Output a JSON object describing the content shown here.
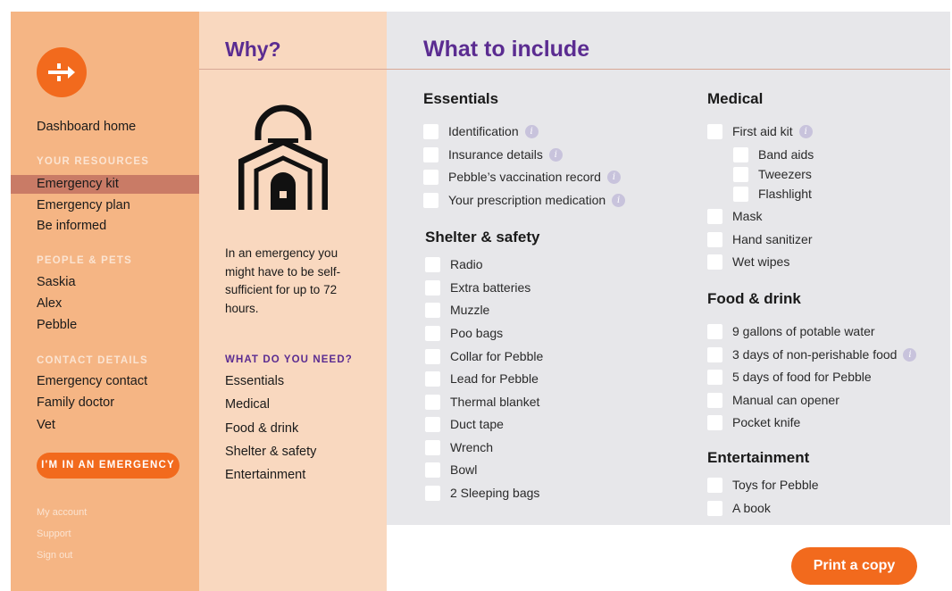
{
  "sidebar": {
    "dashboard_home": "Dashboard home",
    "section_resources": "YOUR RESOURCES",
    "resources": [
      "Emergency kit",
      "Emergency plan",
      "Be informed"
    ],
    "section_people": "PEOPLE & PETS",
    "people": [
      "Saskia",
      "Alex",
      "Pebble"
    ],
    "section_contacts": "CONTACT DETAILS",
    "contacts": [
      "Emergency contact",
      "Family doctor",
      "Vet"
    ],
    "emergency_button": "I'M IN AN EMERGENCY",
    "footer_links": [
      "My account",
      "Support",
      "Sign out"
    ]
  },
  "why": {
    "title": "Why?",
    "text": "In an emergency you might have to be self-sufficient for up to 72 hours.",
    "need_heading": "WHAT DO YOU NEED?",
    "links": [
      "Essentials",
      "Medical",
      "Food & drink",
      "Shelter & safety",
      "Entertainment"
    ]
  },
  "main": {
    "title": "What to include",
    "essentials": {
      "title": "Essentials",
      "items": [
        "Identification",
        "Insurance details",
        "Pebble’s vaccination record",
        "Your prescription medication"
      ]
    },
    "shelter": {
      "title": "Shelter & safety",
      "items": [
        "Radio",
        "Extra batteries",
        "Muzzle",
        "Poo bags",
        "Collar for Pebble",
        "Lead for Pebble",
        "Thermal blanket",
        "Duct tape",
        "Wrench",
        "Bowl",
        "2 Sleeping bags"
      ]
    },
    "medical": {
      "title": "Medical",
      "items": [
        "First aid kit",
        "Band aids",
        "Tweezers",
        "Flashlight",
        "Mask",
        "Hand sanitizer",
        "Wet wipes"
      ]
    },
    "food": {
      "title": "Food & drink",
      "items": [
        "9 gallons of potable water",
        "3 days of non-perishable food",
        "5 days of food for Pebble",
        "Manual can opener",
        "Pocket knife"
      ]
    },
    "entertainment": {
      "title": "Entertainment",
      "items": [
        "Toys for Pebble",
        "A book"
      ]
    },
    "info_glyph": "i"
  },
  "print_button": "Print a copy",
  "colors": {
    "accent_orange": "#f26a1d",
    "sidebar_bg": "#f5b584",
    "why_bg": "#f9d8bf",
    "main_bg": "#e7e7ea",
    "purple": "#5b2c91",
    "active_row": "#c97b66"
  }
}
